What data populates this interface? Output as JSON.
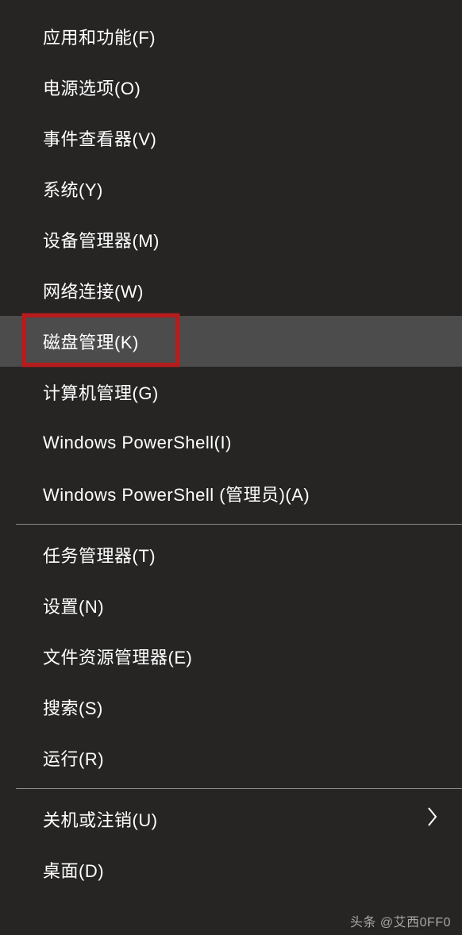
{
  "menu": {
    "groups": [
      {
        "items": [
          {
            "label": "应用和功能(F)",
            "hasSubmenu": false,
            "highlighted": false,
            "boxed": false
          },
          {
            "label": "电源选项(O)",
            "hasSubmenu": false,
            "highlighted": false,
            "boxed": false
          },
          {
            "label": "事件查看器(V)",
            "hasSubmenu": false,
            "highlighted": false,
            "boxed": false
          },
          {
            "label": "系统(Y)",
            "hasSubmenu": false,
            "highlighted": false,
            "boxed": false
          },
          {
            "label": "设备管理器(M)",
            "hasSubmenu": false,
            "highlighted": false,
            "boxed": false
          },
          {
            "label": "网络连接(W)",
            "hasSubmenu": false,
            "highlighted": false,
            "boxed": false
          },
          {
            "label": "磁盘管理(K)",
            "hasSubmenu": false,
            "highlighted": true,
            "boxed": true
          },
          {
            "label": "计算机管理(G)",
            "hasSubmenu": false,
            "highlighted": false,
            "boxed": false
          },
          {
            "label": "Windows PowerShell(I)",
            "hasSubmenu": false,
            "highlighted": false,
            "boxed": false
          },
          {
            "label": "Windows PowerShell (管理员)(A)",
            "hasSubmenu": false,
            "highlighted": false,
            "boxed": false
          }
        ]
      },
      {
        "items": [
          {
            "label": "任务管理器(T)",
            "hasSubmenu": false,
            "highlighted": false,
            "boxed": false
          },
          {
            "label": "设置(N)",
            "hasSubmenu": false,
            "highlighted": false,
            "boxed": false
          },
          {
            "label": "文件资源管理器(E)",
            "hasSubmenu": false,
            "highlighted": false,
            "boxed": false
          },
          {
            "label": "搜索(S)",
            "hasSubmenu": false,
            "highlighted": false,
            "boxed": false
          },
          {
            "label": "运行(R)",
            "hasSubmenu": false,
            "highlighted": false,
            "boxed": false
          }
        ]
      },
      {
        "items": [
          {
            "label": "关机或注销(U)",
            "hasSubmenu": true,
            "highlighted": false,
            "boxed": false
          },
          {
            "label": "桌面(D)",
            "hasSubmenu": false,
            "highlighted": false,
            "boxed": false
          }
        ]
      }
    ]
  },
  "watermark": "头条 @艾西0FF0"
}
